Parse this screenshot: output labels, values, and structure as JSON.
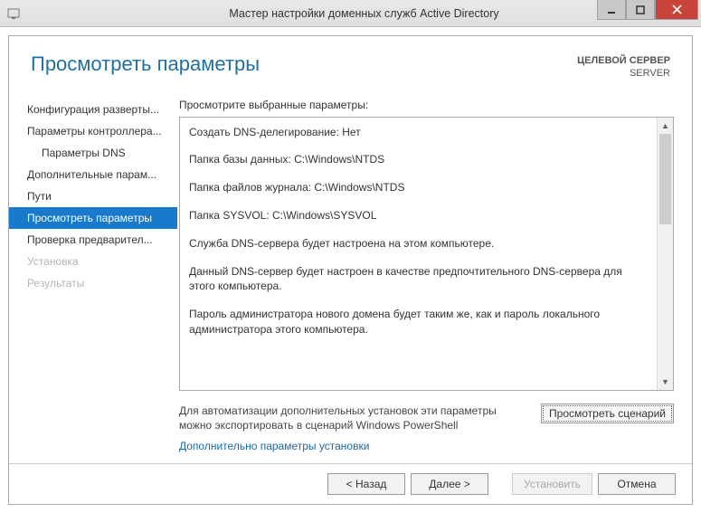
{
  "titlebar": {
    "title": "Мастер настройки доменных служб Active Directory"
  },
  "header": {
    "title": "Просмотреть параметры",
    "target_label": "ЦЕЛЕВОЙ СЕРВЕР",
    "target_value": "SERVER"
  },
  "sidebar": {
    "items": [
      {
        "label": "Конфигурация разверты...",
        "indent": false,
        "state": "normal"
      },
      {
        "label": "Параметры контроллера...",
        "indent": false,
        "state": "normal"
      },
      {
        "label": "Параметры DNS",
        "indent": true,
        "state": "normal"
      },
      {
        "label": "Дополнительные парам...",
        "indent": false,
        "state": "normal"
      },
      {
        "label": "Пути",
        "indent": false,
        "state": "normal"
      },
      {
        "label": "Просмотреть параметры",
        "indent": false,
        "state": "selected"
      },
      {
        "label": "Проверка предварител...",
        "indent": false,
        "state": "normal"
      },
      {
        "label": "Установка",
        "indent": false,
        "state": "disabled"
      },
      {
        "label": "Результаты",
        "indent": false,
        "state": "disabled"
      }
    ]
  },
  "main": {
    "prompt": "Просмотрите выбранные параметры:",
    "review_lines": [
      "Создать DNS-делегирование: Нет",
      "Папка базы данных: C:\\Windows\\NTDS",
      "Папка файлов журнала: C:\\Windows\\NTDS",
      "Папка SYSVOL: C:\\Windows\\SYSVOL",
      "Служба DNS-сервера будет настроена на этом компьютере.",
      "Данный DNS-сервер будет настроен в качестве предпочтительного DNS-сервера для этого компьютера.",
      "Пароль администратора нового домена будет таким же, как и пароль локального администратора этого компьютера."
    ],
    "under_text": "Для автоматизации дополнительных установок эти параметры можно экспортировать в сценарий Windows PowerShell",
    "script_button": "Просмотреть сценарий",
    "link": "Дополнительно параметры установки"
  },
  "footer": {
    "back": "< Назад",
    "next": "Далее >",
    "install": "Установить",
    "cancel": "Отмена"
  }
}
